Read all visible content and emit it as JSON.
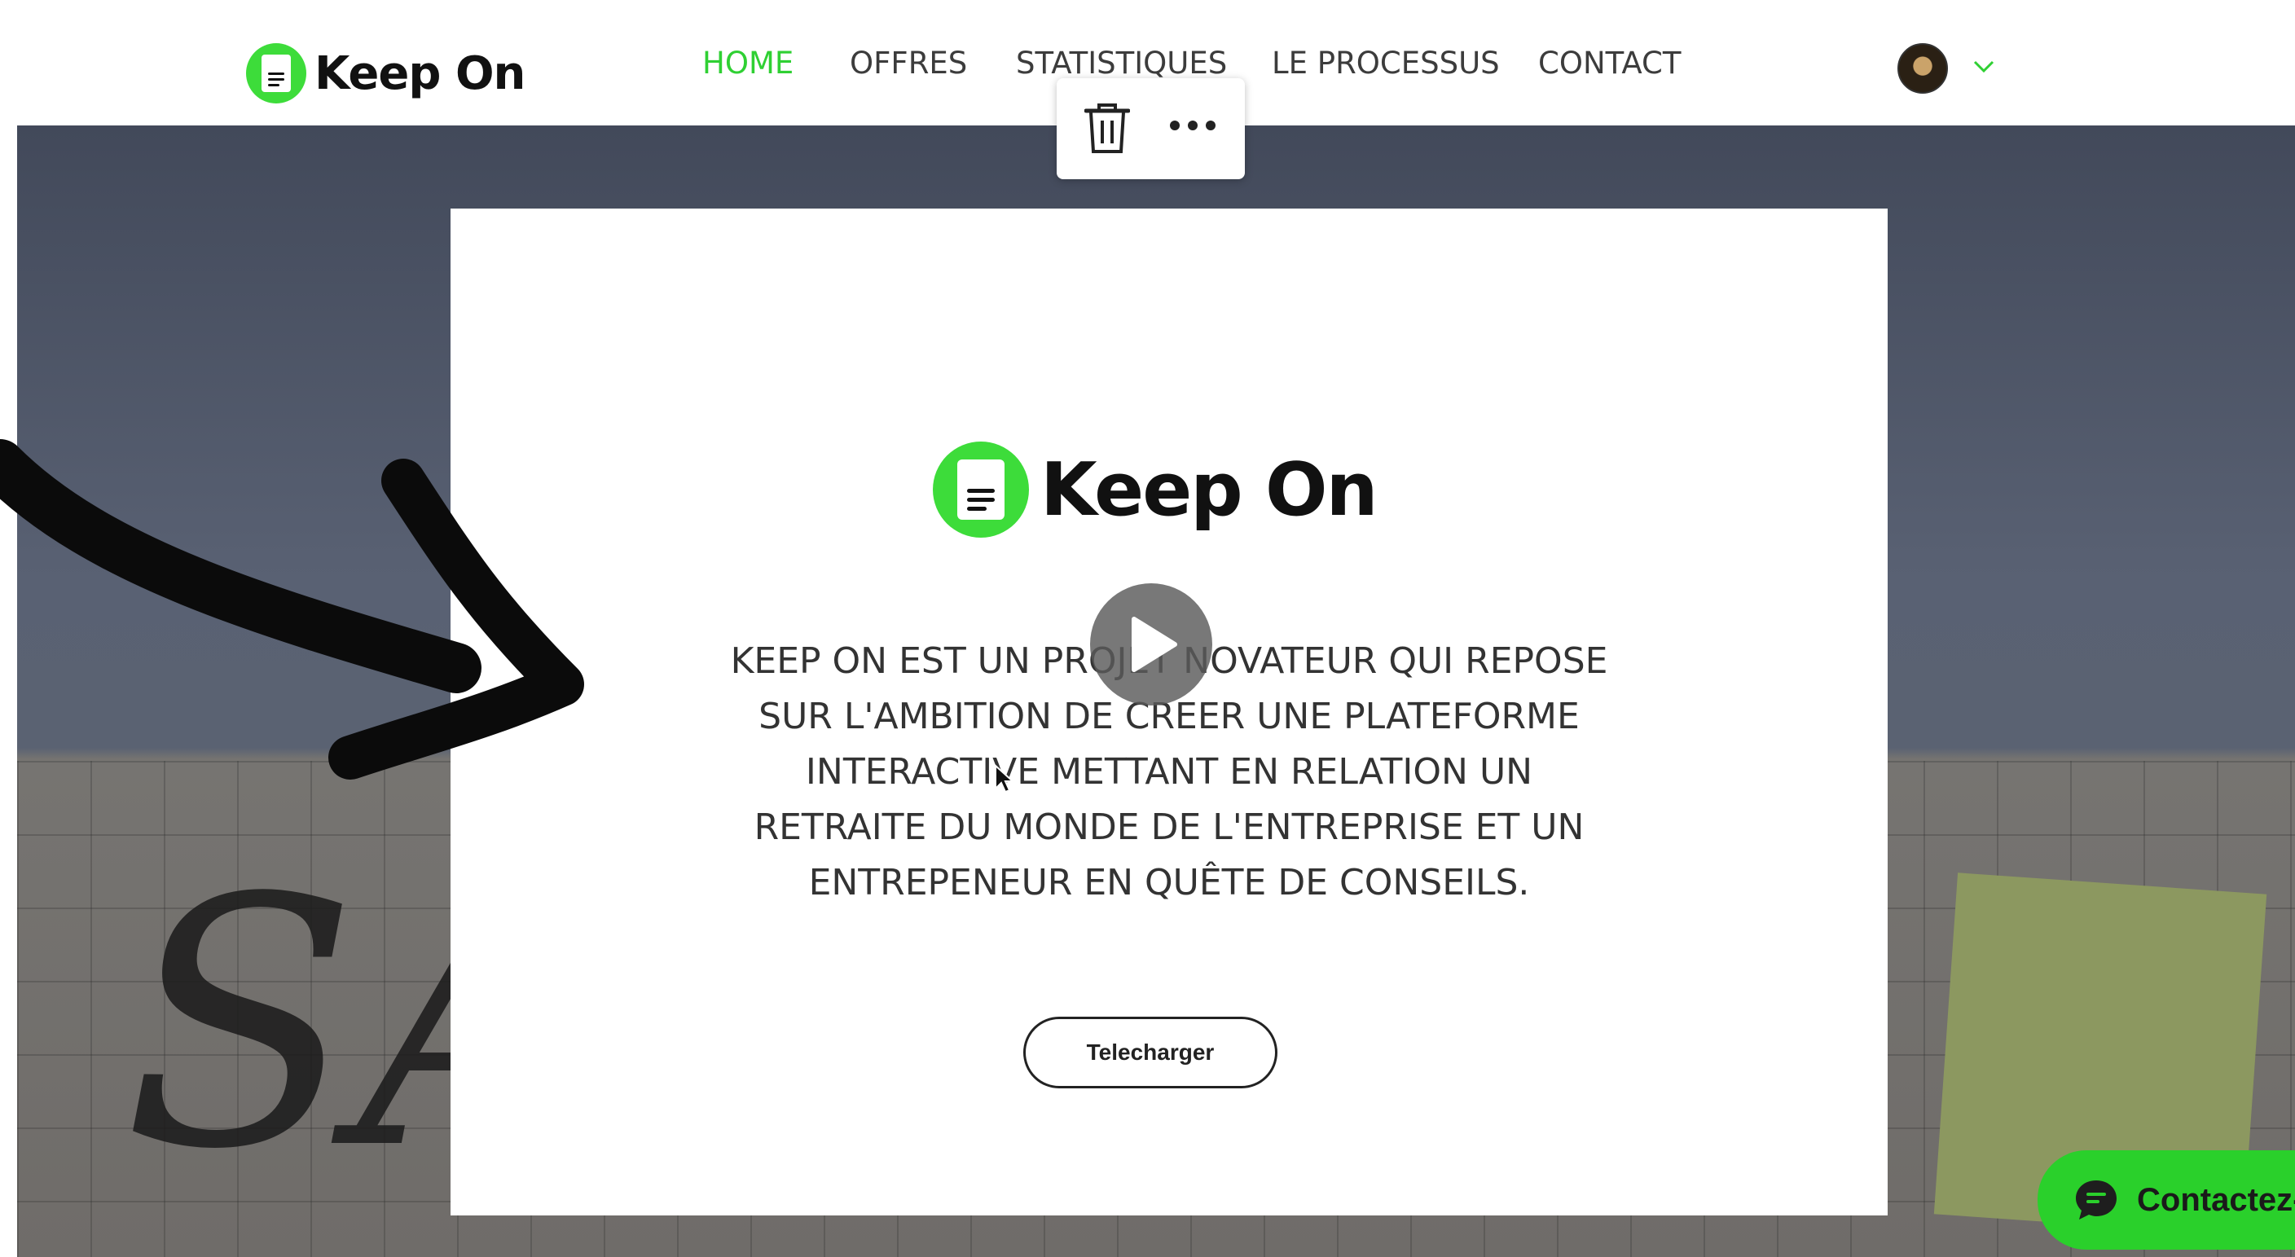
{
  "header": {
    "logo_text": "Keep On",
    "nav": [
      {
        "label": "HOME",
        "active": true
      },
      {
        "label": "OFFRES",
        "active": false
      },
      {
        "label": "STATISTIQUES",
        "active": false
      },
      {
        "label": "LE PROCESSUS",
        "active": false
      },
      {
        "label": "CONTACT",
        "active": false
      }
    ]
  },
  "toolbar": {
    "delete_icon": "trash-icon",
    "more_icon": "more-horizontal-icon"
  },
  "card": {
    "logo_text": "Keep On",
    "description_lines": [
      "KEEP ON EST UN PROJET NOVATEUR QUI REPOSE",
      "SUR L'AMBITION DE CREER UNE PLATEFORME",
      "INTERACTIVE METTANT EN RELATION UN",
      "RETRAITE DU MONDE DE L'ENTREPRISE ET UN",
      "ENTREPENEUR EN QUÊTE DE CONSEILS."
    ],
    "download_label": "Telecharger"
  },
  "chat": {
    "label": "Contactez-"
  },
  "colors": {
    "accent": "#2fd033",
    "logo_green": "#3ddc3a",
    "chat_green": "#2ad02b"
  }
}
